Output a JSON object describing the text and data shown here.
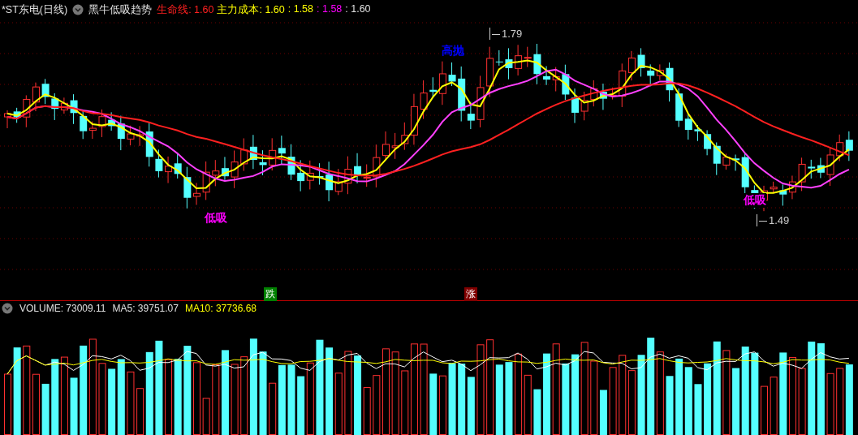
{
  "header": {
    "stock_name": "*ST东电(日线)",
    "indicator_name": "黑牛低吸趋势",
    "legend": [
      {
        "text": "生命线: 1.60",
        "color": "#ff2020"
      },
      {
        "text": "主力成本: 1.60",
        "color": "#ffff00"
      },
      {
        "text": ": 1.58",
        "color": "#ffff00"
      },
      {
        "text": ": 1.58",
        "color": "#ff00ff"
      },
      {
        "text": ": 1.60",
        "color": "#e0e0e0"
      }
    ]
  },
  "annotations": [
    {
      "kind": "signal",
      "text": "高抛",
      "color": "#0000ff"
    },
    {
      "kind": "signal",
      "text": "低吸",
      "color": "#ff00ff"
    },
    {
      "kind": "signal",
      "text": "低吸",
      "color": "#ff00ff"
    },
    {
      "kind": "price",
      "text": "1.79"
    },
    {
      "kind": "price",
      "text": "1.49"
    },
    {
      "kind": "badge",
      "text": "跌",
      "color": "#008000"
    },
    {
      "kind": "badge",
      "text": "涨",
      "color": "#800000"
    }
  ],
  "volume_header": [
    {
      "text": "VOLUME: 73009.11",
      "color": "#e0e0e0"
    },
    {
      "text": "MA5: 39751.07",
      "color": "#e0e0e0"
    },
    {
      "text": "MA10: 37736.68",
      "color": "#ffff00"
    }
  ]
}
